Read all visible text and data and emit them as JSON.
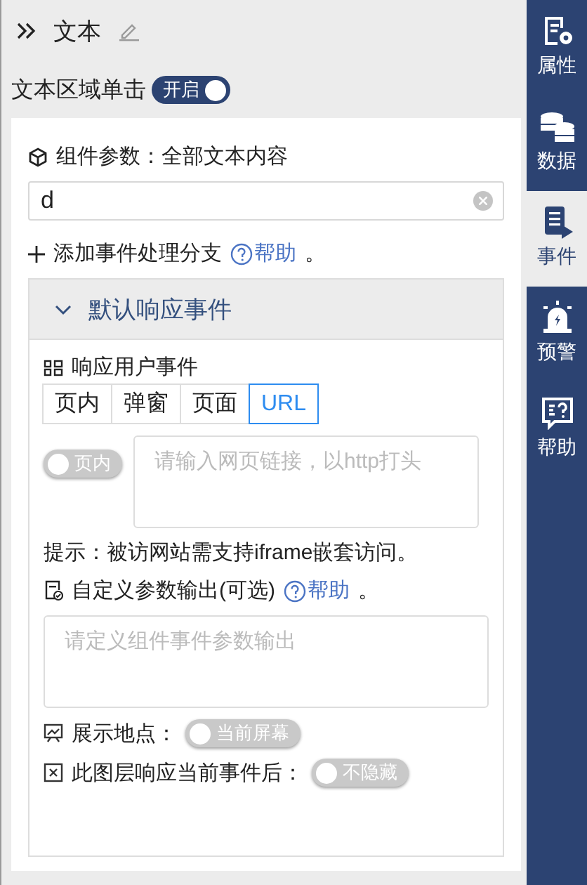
{
  "header": {
    "title": "文本"
  },
  "click_toggle": {
    "label": "文本区域单击",
    "on": true,
    "text": "开启"
  },
  "params": {
    "label": "组件参数：全部文本内容",
    "value": "d",
    "add_branch": "添加事件处理分支",
    "help": "帮助",
    "period": "。"
  },
  "event_panel": {
    "title": "默认响应事件",
    "expanded": true,
    "section_label": "响应用户事件",
    "tabs": [
      {
        "label": "页内",
        "selected": false
      },
      {
        "label": "弹窗",
        "selected": false
      },
      {
        "label": "页面",
        "selected": false
      },
      {
        "label": "URL",
        "selected": true
      }
    ],
    "link_toggle": {
      "on": false,
      "text": "页内"
    },
    "url_placeholder": "请输入网页链接，以http打头",
    "hint": "提示：被访网站需支持iframe嵌套访问。",
    "output_label": "自定义参数输出(可选)",
    "output_help": "帮助",
    "output_period": "。",
    "output_placeholder": "请定义组件事件参数输出",
    "options": [
      {
        "kind": "screen",
        "label": "展示地点：",
        "on": false,
        "text": "当前屏幕"
      },
      {
        "kind": "cross",
        "label": "此图层响应当前事件后：",
        "on": false,
        "text": "不隐藏"
      }
    ]
  },
  "sidebar": [
    {
      "kind": "form",
      "label": "属性",
      "selected": false
    },
    {
      "kind": "database",
      "label": "数据",
      "selected": false
    },
    {
      "kind": "list",
      "label": "事件",
      "selected": true
    },
    {
      "kind": "alarm",
      "label": "预警",
      "selected": false
    },
    {
      "kind": "help",
      "label": "帮助",
      "selected": false
    }
  ]
}
